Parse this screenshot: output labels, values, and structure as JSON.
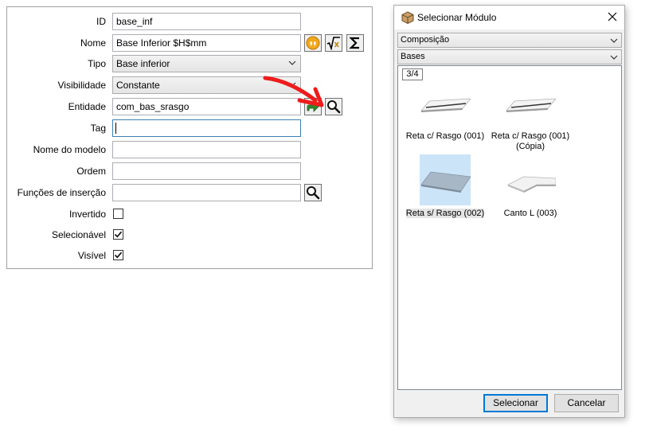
{
  "props": {
    "rows": [
      {
        "label": "ID",
        "value": "base_inf"
      },
      {
        "label": "Nome",
        "value": "Base Inferior $H$mm"
      },
      {
        "label": "Tipo",
        "value": "Base inferior"
      },
      {
        "label": "Visibilidade",
        "value": "Constante"
      },
      {
        "label": "Entidade",
        "value": "com_bas_srasgo"
      },
      {
        "label": "Tag",
        "value": ""
      },
      {
        "label": "Nome do modelo",
        "value": ""
      },
      {
        "label": "Ordem",
        "value": ""
      },
      {
        "label": "Funções de inserção",
        "value": ""
      },
      {
        "label": "Invertido",
        "checked": false
      },
      {
        "label": "Selecionável",
        "checked": true
      },
      {
        "label": "Visível",
        "checked": true
      }
    ]
  },
  "annotation": {
    "arrow_color": "#ee1c1c"
  },
  "dialog": {
    "title": "Selecionar Módulo",
    "category": "Composição",
    "subcategory": "Bases",
    "page": "3/4",
    "items": [
      {
        "label": "Reta c/ Rasgo (001)",
        "selected": false
      },
      {
        "label": "Reta c/ Rasgo (001) (Cópia)",
        "selected": false
      },
      {
        "label": "Reta s/ Rasgo (002)",
        "selected": true
      },
      {
        "label": "Canto L (003)",
        "selected": false
      }
    ],
    "select_button": "Selecionar",
    "cancel_button": "Cancelar"
  },
  "colors": {
    "selection": "#cce4f7",
    "accent": "#0078d7"
  }
}
